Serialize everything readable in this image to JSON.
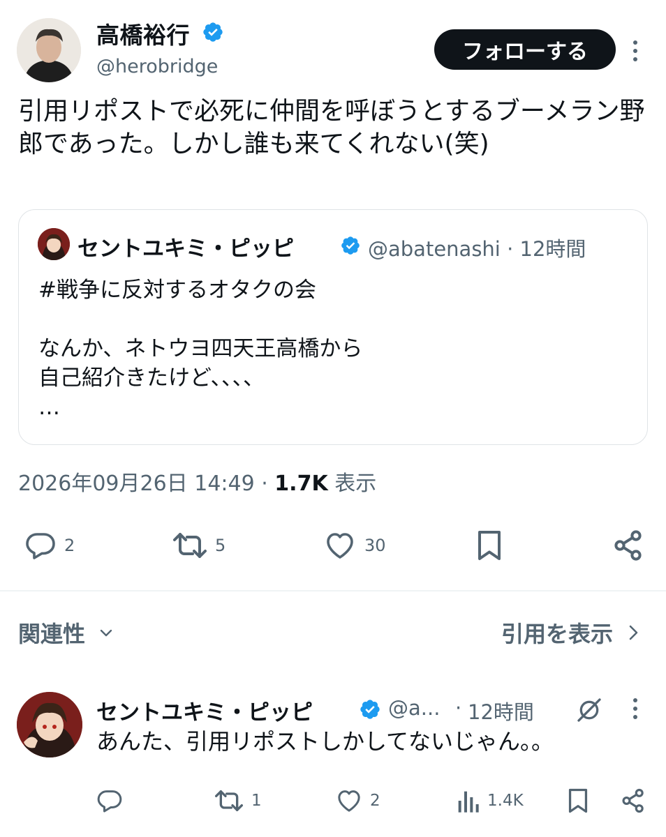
{
  "colors": {
    "text": "#0f1419",
    "secondary": "#536471",
    "verified": "#1d9bf0",
    "follow_bg": "#0f1419",
    "border": "#dfe3e6"
  },
  "main_tweet": {
    "author_name": "高橋裕行",
    "author_handle": "@herobridge",
    "follow_label": "フォローする",
    "text": "引用リポストで必死に仲間を呼ぼうとするブーメラン野郎であった。しかし誰も来てくれない(笑)",
    "quote": {
      "author_name": "セントユキミ・ピッピ",
      "handle_time": "@abatenashi · 12時間",
      "text": "#戦争に反対するオタクの会\n\nなんか、ネトウヨ四天王高橋から\n自己紹介きたけど、、、、\n…"
    },
    "timestamp": "2026年09月26日 14:49",
    "separator": " · ",
    "views_count": "1.7K",
    "views_label": " 表示",
    "actions": {
      "reply_count": "2",
      "retweet_count": "5",
      "like_count": "30"
    },
    "icons": [
      "verified-icon",
      "more-icon",
      "reply-icon",
      "retweet-icon",
      "like-icon",
      "bookmark-icon",
      "share-icon"
    ]
  },
  "filters": {
    "relevance_label": "関連性",
    "view_quotes_label": "引用を表示"
  },
  "reply_tweet": {
    "author_name": "セントユキミ・ピッピ",
    "handle": "@a...",
    "dot": "·",
    "time": "12時間",
    "text": "あんた、引用リポストしかしてないじゃん。。",
    "actions": {
      "reply_count": "",
      "retweet_count": "1",
      "like_count": "2",
      "views_count": "1.4K"
    },
    "icons": [
      "grok-icon",
      "more-icon",
      "views-icon"
    ]
  }
}
